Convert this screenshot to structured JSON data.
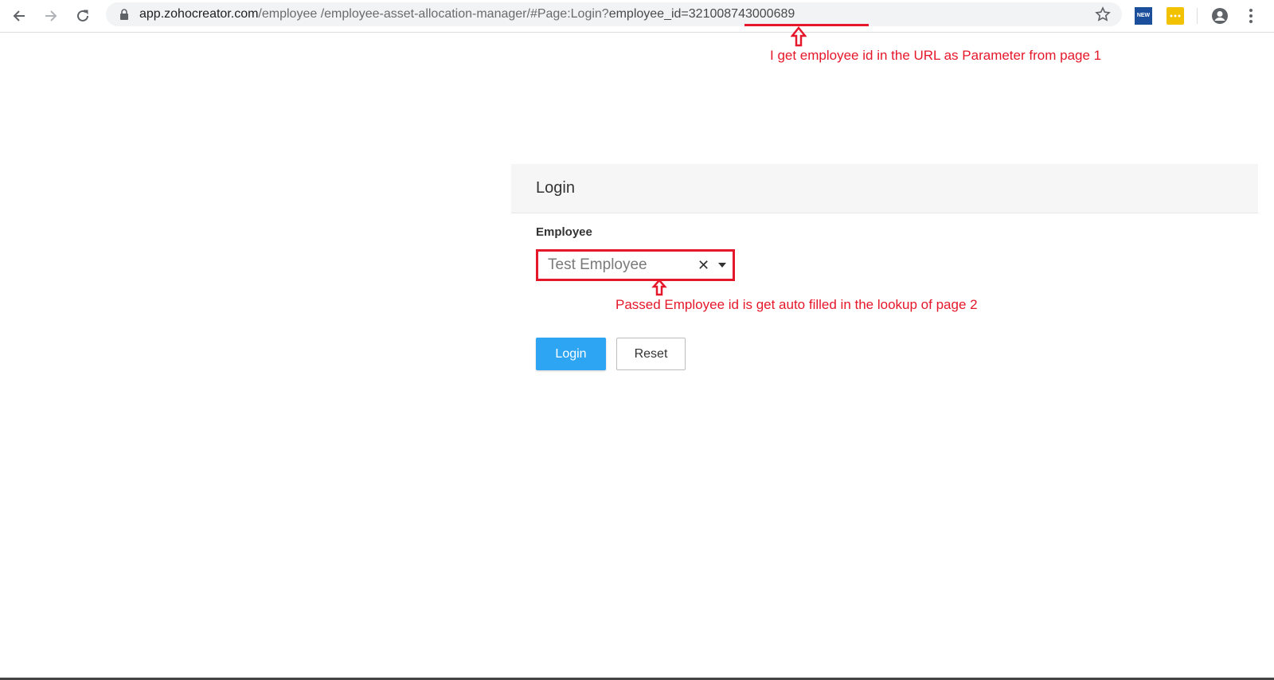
{
  "browser": {
    "url": {
      "host": "app.zohocreator.com",
      "path1": "/employee",
      "path2": " /employee-asset-allocation-manager/#Page:Login?",
      "param_key": "employee_id=",
      "param_value": "321008743000689"
    },
    "extension_new_label": "NEW"
  },
  "annotations": {
    "url_note_part1": "I get employee id in the URL as Parameter",
    "url_note_part2": "from page 1",
    "lookup_note": "Passed Employee id is get auto filled in the lookup of page 2",
    "color": "#e5172a"
  },
  "form": {
    "title": "Login",
    "employee_label": "Employee",
    "employee_value": "Test Employee",
    "clear_symbol": "✕",
    "login_button": "Login",
    "reset_button": "Reset"
  },
  "colors": {
    "primary_button": "#2ea5f2",
    "annotation_red": "#e5172a"
  }
}
